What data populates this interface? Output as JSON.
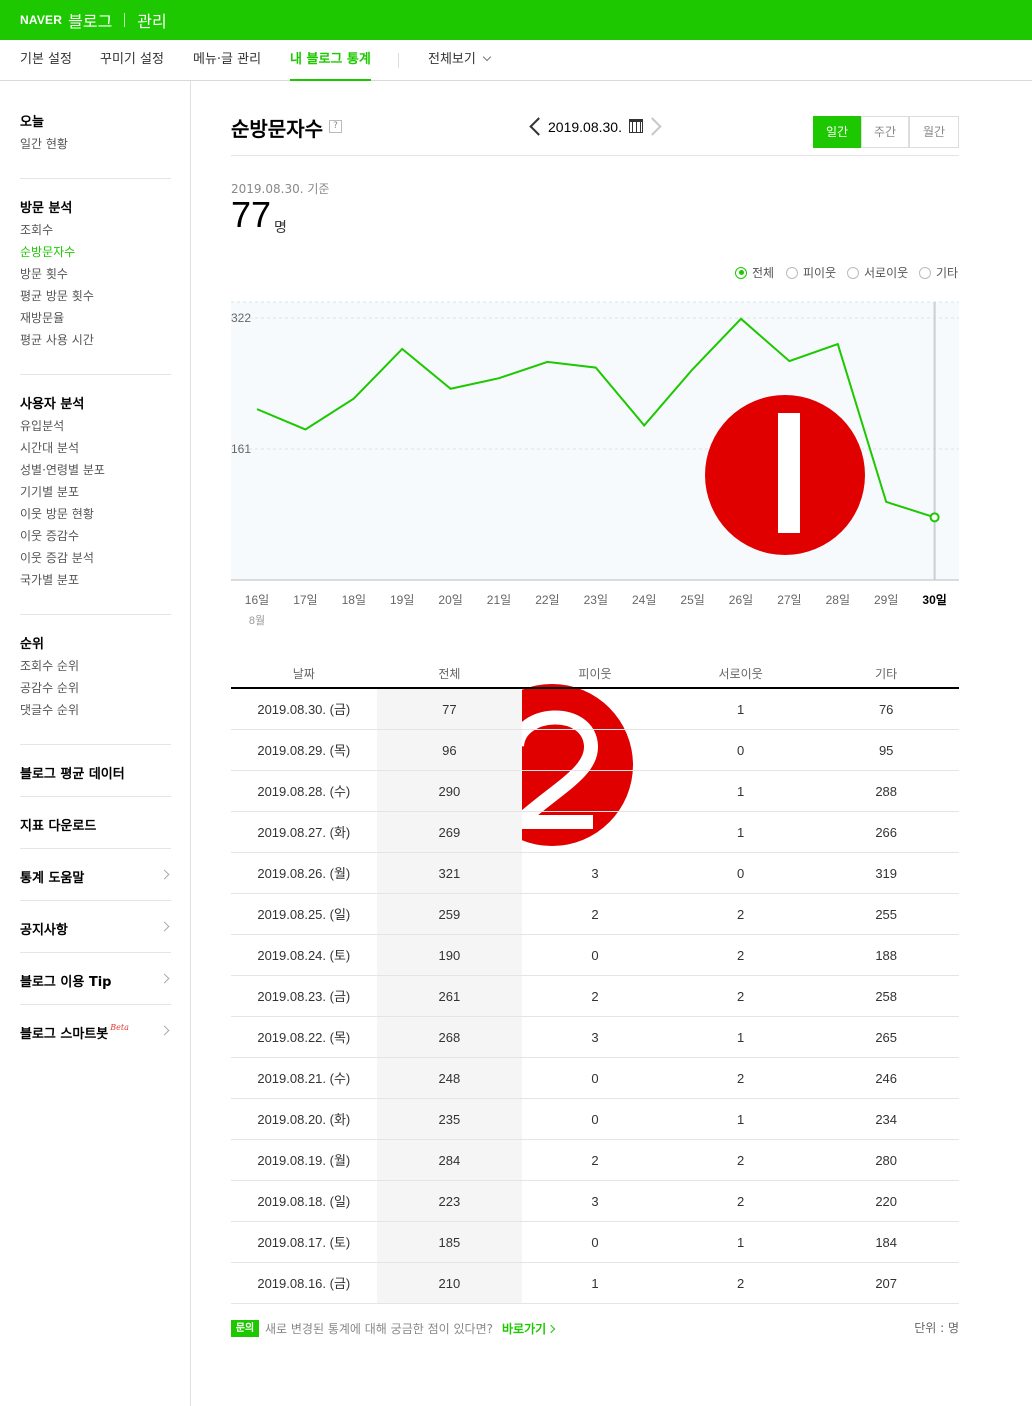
{
  "topbar": {
    "brand": "NAVER",
    "service": "블로그",
    "section": "관리"
  },
  "tabs": [
    {
      "label": "기본 설정"
    },
    {
      "label": "꾸미기 설정"
    },
    {
      "label": "메뉴·글 관리"
    },
    {
      "label": "내 블로그 통계",
      "active": true
    },
    {
      "label": "전체보기"
    }
  ],
  "sidebar": {
    "today": {
      "title": "오늘",
      "items": [
        "일간 현황"
      ]
    },
    "visit": {
      "title": "방문 분석",
      "items": [
        "조회수",
        "순방문자수",
        "방문 횟수",
        "평균 방문 횟수",
        "재방문율",
        "평균 사용 시간"
      ],
      "active_index": 1
    },
    "user": {
      "title": "사용자 분석",
      "items": [
        "유입분석",
        "시간대 분석",
        "성별·연령별 분포",
        "기기별 분포",
        "이웃 방문 현황",
        "이웃 증감수",
        "이웃 증감 분석",
        "국가별 분포"
      ]
    },
    "rank": {
      "title": "순위",
      "items": [
        "조회수 순위",
        "공감수 순위",
        "댓글수 순위"
      ]
    },
    "links": {
      "avg": "블로그 평균 데이터",
      "download": "지표 다운로드",
      "help": "통계 도움말",
      "notice": "공지사항",
      "tip": "블로그 이용 Tip",
      "smartbot": "블로그 스마트봇",
      "beta": "Beta"
    }
  },
  "header": {
    "title": "순방문자수",
    "help": "?",
    "date": "2019.08.30.",
    "periods": [
      "일간",
      "주간",
      "월간"
    ],
    "active_period": "일간"
  },
  "summary": {
    "basis": "2019.08.30. 기준",
    "value": "77",
    "unit": "명"
  },
  "filters": [
    "전체",
    "피이웃",
    "서로이웃",
    "기타"
  ],
  "chart_data": {
    "type": "line",
    "categories": [
      "16일",
      "17일",
      "18일",
      "19일",
      "20일",
      "21일",
      "22일",
      "23일",
      "24일",
      "25일",
      "26일",
      "27일",
      "28일",
      "29일",
      "30일"
    ],
    "x_sublabel": "8월",
    "values": [
      210,
      185,
      223,
      284,
      235,
      248,
      268,
      261,
      190,
      259,
      321,
      269,
      290,
      96,
      77
    ],
    "yticks": [
      161,
      322
    ],
    "ylim": [
      0,
      322
    ],
    "highlight_last": true,
    "color": "#1ec800"
  },
  "table": {
    "headers": [
      "날짜",
      "전체",
      "피이웃",
      "서로이웃",
      "기타"
    ],
    "rows": [
      [
        "2019.08.30. (금)",
        "77",
        "",
        "1",
        "76"
      ],
      [
        "2019.08.29. (목)",
        "96",
        "",
        "0",
        "95"
      ],
      [
        "2019.08.28. (수)",
        "290",
        "",
        "1",
        "288"
      ],
      [
        "2019.08.27. (화)",
        "269",
        "",
        "1",
        "266"
      ],
      [
        "2019.08.26. (월)",
        "321",
        "3",
        "0",
        "319"
      ],
      [
        "2019.08.25. (일)",
        "259",
        "2",
        "2",
        "255"
      ],
      [
        "2019.08.24. (토)",
        "190",
        "0",
        "2",
        "188"
      ],
      [
        "2019.08.23. (금)",
        "261",
        "2",
        "2",
        "258"
      ],
      [
        "2019.08.22. (목)",
        "268",
        "3",
        "1",
        "265"
      ],
      [
        "2019.08.21. (수)",
        "248",
        "0",
        "2",
        "246"
      ],
      [
        "2019.08.20. (화)",
        "235",
        "0",
        "1",
        "234"
      ],
      [
        "2019.08.19. (월)",
        "284",
        "2",
        "2",
        "280"
      ],
      [
        "2019.08.18. (일)",
        "223",
        "3",
        "2",
        "220"
      ],
      [
        "2019.08.17. (토)",
        "185",
        "0",
        "1",
        "184"
      ],
      [
        "2019.08.16. (금)",
        "210",
        "1",
        "2",
        "207"
      ]
    ]
  },
  "footer": {
    "badge": "문의",
    "text": "새로 변경된 통계에 대해 궁금한 점이 있다면?",
    "link": "바로가기",
    "unit_note": "단위 : 명"
  },
  "overlays": {
    "marker1": "1",
    "marker2": "2",
    "color": "#e00000"
  }
}
